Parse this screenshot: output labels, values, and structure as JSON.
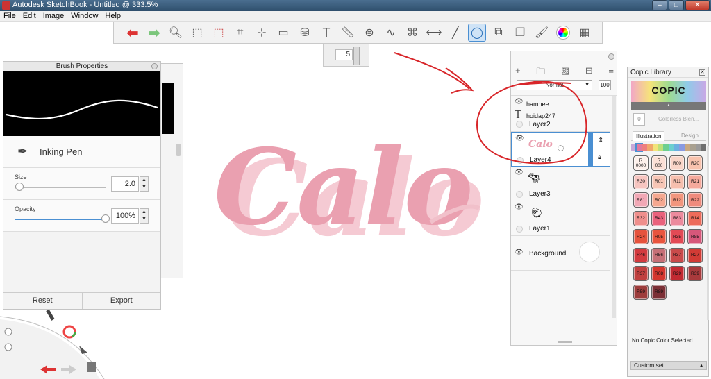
{
  "window": {
    "title": "Autodesk SketchBook - Untitled @ 333.5%"
  },
  "menu": [
    "File",
    "Edit",
    "Image",
    "Window",
    "Help"
  ],
  "toolbar": {
    "tools": [
      "undo",
      "redo",
      "zoom",
      "select-rect",
      "select-lasso",
      "crop",
      "transform",
      "distort",
      "fill",
      "text",
      "ruler",
      "ellipse",
      "french-curve",
      "perspective",
      "symmetry",
      "stroke",
      "predictive-stroke",
      "shape",
      "copy",
      "brushes",
      "color-wheel",
      "copic"
    ],
    "brush_size_value": "5"
  },
  "brush_properties": {
    "title": "Brush Properties",
    "brush_name": "Inking Pen",
    "size_label": "Size",
    "size_value": "2.0",
    "size_fraction": 0.02,
    "opacity_label": "Opacity",
    "opacity_value": "100%",
    "opacity_fraction": 1.0,
    "reset_label": "Reset",
    "export_label": "Export"
  },
  "layers": {
    "blend_mode": "Normal",
    "opacity": "100",
    "items": [
      {
        "name": "hamnee",
        "type": "text"
      },
      {
        "name": "hoidap247",
        "type": "text"
      },
      {
        "name": "Layer2",
        "type": "layer"
      },
      {
        "name": "Layer4",
        "type": "layer",
        "selected": true
      },
      {
        "name": "Layer3",
        "type": "layer"
      },
      {
        "name": "Layer1",
        "type": "layer"
      },
      {
        "name": "Background",
        "type": "background"
      }
    ]
  },
  "copic": {
    "title": "Copic Library",
    "logo": "COPIC",
    "colorless_blender": "Colorless Blen...",
    "blender_code": "0",
    "tab_illustration": "Illustration",
    "tab_design": "Design",
    "swatches": [
      {
        "code": "R\n0000",
        "color": "#fdf1ec"
      },
      {
        "code": "R\n000",
        "color": "#fbe0d6"
      },
      {
        "code": "R00",
        "color": "#f9d5c8"
      },
      {
        "code": "R20",
        "color": "#f8c3ae"
      },
      {
        "code": "R30",
        "color": "#f6c5c0"
      },
      {
        "code": "R01",
        "color": "#f7c6b6"
      },
      {
        "code": "R11",
        "color": "#f6bfae"
      },
      {
        "code": "R21",
        "color": "#f5a99c"
      },
      {
        "code": "R81",
        "color": "#f1a8b5"
      },
      {
        "code": "R02",
        "color": "#f5a890"
      },
      {
        "code": "R12",
        "color": "#f2967e"
      },
      {
        "code": "R22",
        "color": "#ef8b7d"
      },
      {
        "code": "R32",
        "color": "#ef8f8c"
      },
      {
        "code": "R43",
        "color": "#e9627c"
      },
      {
        "code": "R83",
        "color": "#ec8a9d"
      },
      {
        "code": "R14",
        "color": "#ed6b5a"
      },
      {
        "code": "R24",
        "color": "#e5533d"
      },
      {
        "code": "R05",
        "color": "#e8553e"
      },
      {
        "code": "R35",
        "color": "#e24a55"
      },
      {
        "code": "R85",
        "color": "#d6577a"
      },
      {
        "code": "R46",
        "color": "#d23a3f"
      },
      {
        "code": "R56",
        "color": "#c67077"
      },
      {
        "code": "R37",
        "color": "#c94a4a"
      },
      {
        "code": "R27",
        "color": "#d23b35"
      },
      {
        "code": "R37",
        "color": "#c0403f"
      },
      {
        "code": "R08",
        "color": "#d4372e"
      },
      {
        "code": "R29",
        "color": "#c22a32"
      },
      {
        "code": "R39",
        "color": "#a83a3c"
      },
      {
        "code": "R59",
        "color": "#9d3d3c"
      },
      {
        "code": "R89",
        "color": "#7b2f35"
      }
    ],
    "no_color": "No Copic Color Selected",
    "custom_set": "Custom set"
  },
  "canvas": {
    "artwork_text": "Calo",
    "accent_color": "#eaa0b0"
  }
}
